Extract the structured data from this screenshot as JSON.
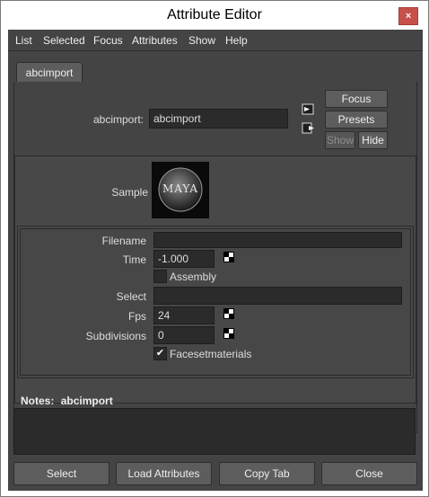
{
  "window": {
    "title": "Attribute Editor",
    "close_glyph": "×"
  },
  "menu": [
    "List",
    "Selected",
    "Focus",
    "Attributes",
    "Show",
    "Help"
  ],
  "tab": {
    "label": "abcimport"
  },
  "node": {
    "label": "abcimport:",
    "value": "abcimport"
  },
  "side_buttons": {
    "focus": "Focus",
    "presets": "Presets",
    "show": "Show",
    "hide": "Hide"
  },
  "sample": {
    "label": "Sample",
    "logo_text": "MAYA"
  },
  "attributes": {
    "filename": {
      "label": "Filename",
      "value": ""
    },
    "time": {
      "label": "Time",
      "value": "-1.000"
    },
    "assembly": {
      "label": "Assembly",
      "checked": false
    },
    "select": {
      "label": "Select",
      "value": ""
    },
    "fps": {
      "label": "Fps",
      "value": "24"
    },
    "subdivisions": {
      "label": "Subdivisions",
      "value": "0"
    },
    "facesetmaterials": {
      "label": "Facesetmaterials",
      "checked": true
    }
  },
  "notes": {
    "label": "Notes:",
    "node": "abcimport",
    "text": ""
  },
  "bottom_buttons": {
    "select": "Select",
    "load": "Load Attributes",
    "copy": "Copy Tab",
    "close": "Close"
  },
  "icons": [
    "close-icon",
    "load-input-icon",
    "load-output-icon",
    "keyframe-icon",
    "checkmark-icon"
  ]
}
